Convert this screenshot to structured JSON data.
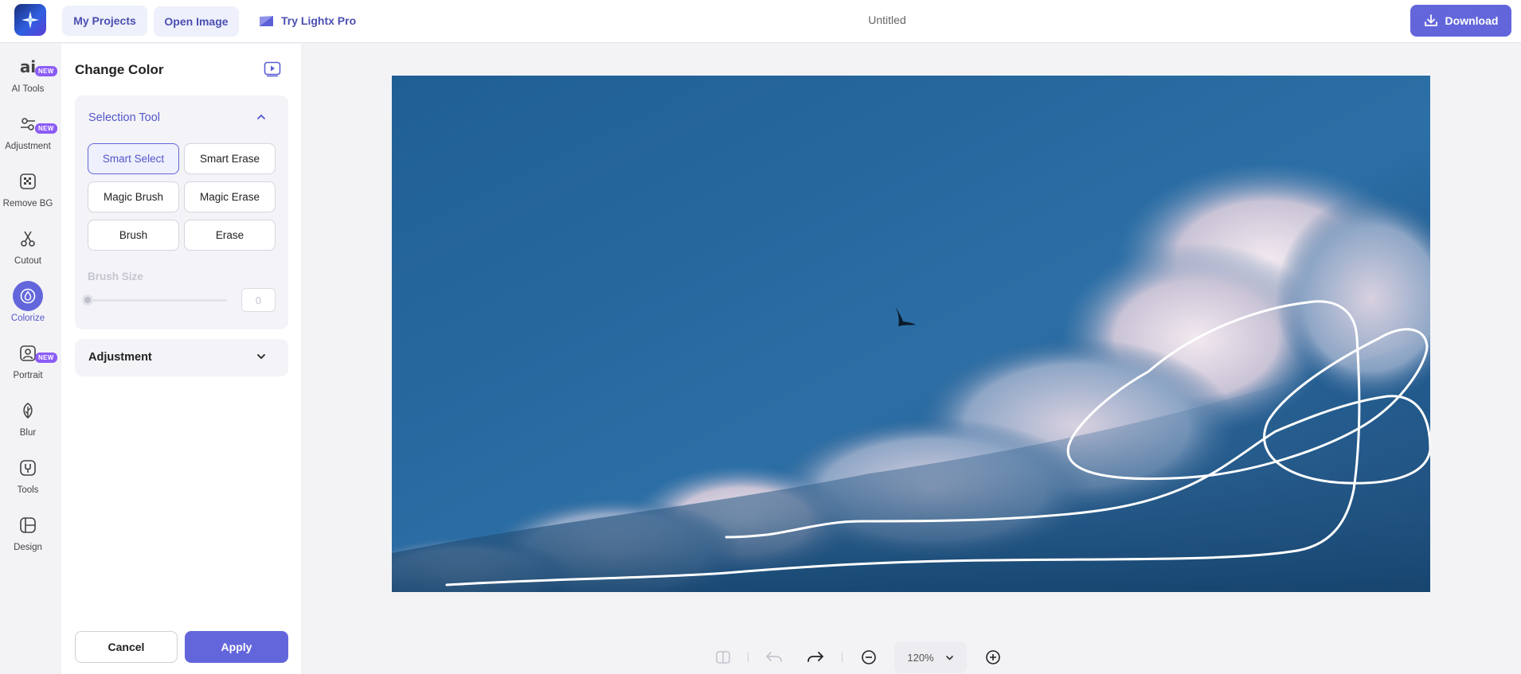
{
  "topbar": {
    "my_projects": "My Projects",
    "open_image": "Open Image",
    "try_pro": "Try Lightx Pro",
    "doc_title": "Untitled",
    "download": "Download"
  },
  "rail": {
    "items": [
      {
        "label": "AI Tools",
        "icon": "ai-icon",
        "badge": "NEW"
      },
      {
        "label": "Adjustment",
        "icon": "sliders-icon",
        "badge": "NEW"
      },
      {
        "label": "Remove BG",
        "icon": "remove-bg-icon"
      },
      {
        "label": "Cutout",
        "icon": "scissors-icon"
      },
      {
        "label": "Colorize",
        "icon": "drop-icon",
        "active": true
      },
      {
        "label": "Portrait",
        "icon": "portrait-icon",
        "badge": "NEW"
      },
      {
        "label": "Blur",
        "icon": "leaf-icon"
      },
      {
        "label": "Tools",
        "icon": "tools-icon"
      },
      {
        "label": "Design",
        "icon": "design-icon"
      }
    ]
  },
  "panel": {
    "title": "Change Color",
    "selection": {
      "heading": "Selection Tool",
      "tools": [
        "Smart Select",
        "Smart Erase",
        "Magic Brush",
        "Magic Erase",
        "Brush",
        "Erase"
      ],
      "active_tool": "Smart Select",
      "brush_size_label": "Brush Size",
      "brush_size_value": "0"
    },
    "adjustment": {
      "heading": "Adjustment"
    },
    "cancel": "Cancel",
    "apply": "Apply"
  },
  "bottom_bar": {
    "zoom": "120%"
  },
  "colors": {
    "accent": "#6366db",
    "active_text": "#5356c8",
    "sky": "#1f5f94"
  }
}
